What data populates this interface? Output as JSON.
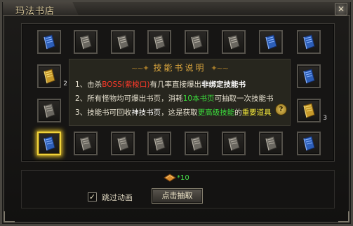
{
  "window": {
    "title": "玛法书店",
    "close_symbol": "✕"
  },
  "info": {
    "title": "技能书说明",
    "ornament_left": "~~✦",
    "ornament_right": "✦~~",
    "line1": {
      "pre": "1、击杀",
      "boss": "BOSS(紫梭口)",
      "mid": "有几率直接爆出",
      "bold": "非绑定技能书"
    },
    "line2": {
      "pre": "2、所有怪物均可爆出书页，消耗",
      "green": "10本书页",
      "post": "可抽取一次技能书"
    },
    "line3": {
      "pre": "3、技能书可回收",
      "white": "神技书页",
      "mid": "，这是获取",
      "green": "更高级技能",
      "post": "的",
      "yel": "重要道具"
    },
    "help_symbol": "?"
  },
  "slots": [
    {
      "book": "blue"
    },
    {
      "book": "gray"
    },
    {
      "book": "gray"
    },
    {
      "book": "gray"
    },
    {
      "book": "gray"
    },
    {
      "book": "gray"
    },
    {
      "book": "blue"
    },
    {
      "book": "blue"
    },
    {
      "book": "gold",
      "count": "2"
    },
    {
      "book": "blue"
    },
    {
      "book": "gray"
    },
    {
      "book": "gold",
      "count": "3"
    },
    {
      "book": "blue",
      "selected": true
    },
    {
      "book": "gray"
    },
    {
      "book": "gray"
    },
    {
      "book": "gray"
    },
    {
      "book": "gray"
    },
    {
      "book": "gray"
    },
    {
      "book": "gray"
    },
    {
      "book": "blue"
    }
  ],
  "cost": {
    "text": "*10"
  },
  "skip_anim": {
    "label": "跳过动画",
    "checked": true,
    "mark": "✓"
  },
  "draw_button": {
    "label": "点击抽取"
  },
  "colors": {
    "accent": "#d9a53e",
    "green": "#3cdc3c",
    "red": "#ff3a2a",
    "highlight": "#f1d33a"
  }
}
